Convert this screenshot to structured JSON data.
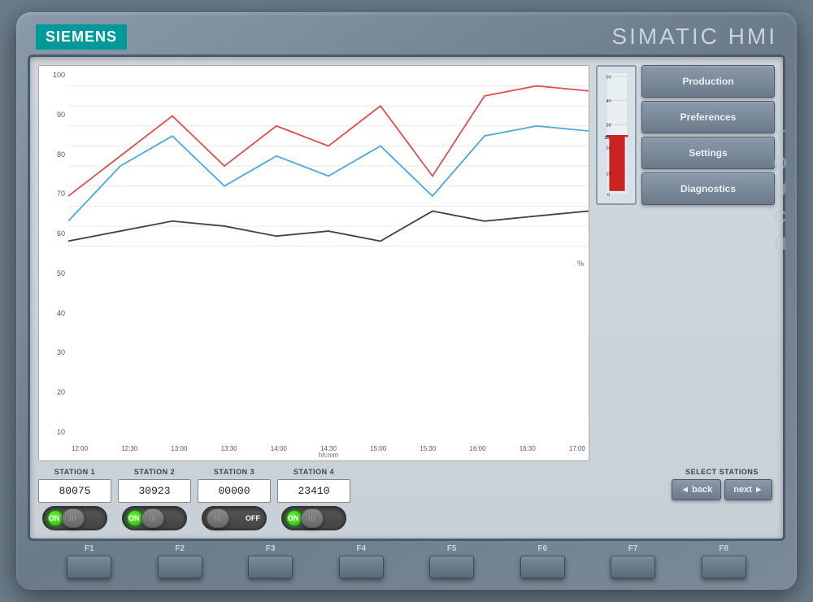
{
  "brand": {
    "siemens": "SIEMENS",
    "product": "SIMATIC HMI",
    "touch": "TOUCH"
  },
  "nav_buttons": [
    {
      "label": "Production",
      "id": "production"
    },
    {
      "label": "Preferences",
      "id": "preferences"
    },
    {
      "label": "Settings",
      "id": "settings"
    },
    {
      "label": "Diagnostics",
      "id": "diagnostics"
    }
  ],
  "chart": {
    "y_labels": [
      "100",
      "90",
      "80",
      "70",
      "60",
      "50",
      "40",
      "30",
      "20",
      "10"
    ],
    "x_labels": [
      "12:00",
      "12:30",
      "13:00",
      "13:30",
      "14:00",
      "14:30",
      "15:00",
      "15:30",
      "16:00",
      "16:30",
      "17:00"
    ],
    "x_unit": "hh:mm",
    "percent_label": "%"
  },
  "gauge": {
    "max": 50,
    "current": 25,
    "labels": [
      "50",
      "40",
      "30",
      "25",
      "20",
      "10",
      "0"
    ]
  },
  "stations": [
    {
      "name": "STATION 1",
      "value": "80075",
      "state": "ON"
    },
    {
      "name": "STATION 2",
      "value": "30923",
      "state": "ON"
    },
    {
      "name": "STATION 3",
      "value": "00000",
      "state": "OFF"
    },
    {
      "name": "STATION 4",
      "value": "23410",
      "state": "ON"
    }
  ],
  "select_stations": {
    "label": "SELECT STATIONS",
    "back": "◄ back",
    "next": "next ►"
  },
  "function_keys": [
    "F1",
    "F2",
    "F3",
    "F4",
    "F5",
    "F6",
    "F7",
    "F8"
  ]
}
